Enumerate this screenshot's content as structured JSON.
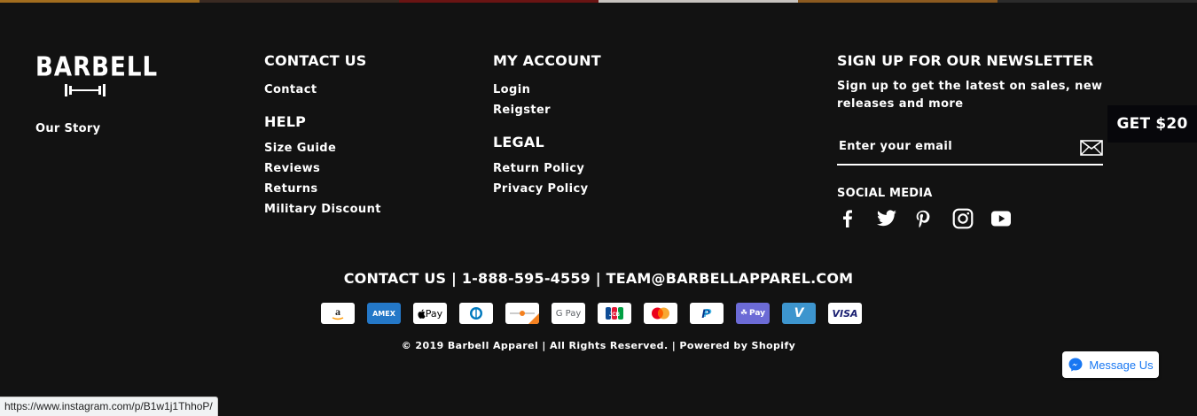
{
  "brand": {
    "logo_text": "BARBELL"
  },
  "left": {
    "our_story": "Our Story"
  },
  "contact_col": {
    "heading": "CONTACT US",
    "links": [
      "Contact"
    ],
    "help_heading": "HELP",
    "help_links": [
      "Size Guide",
      "Reviews",
      "Returns",
      "Military Discount"
    ]
  },
  "account_col": {
    "heading": "MY ACCOUNT",
    "links": [
      "Login",
      "Reigster"
    ],
    "legal_heading": "LEGAL",
    "legal_links": [
      "Return Policy",
      "Privacy Policy"
    ]
  },
  "newsletter": {
    "heading": "SIGN UP FOR OUR NEWSLETTER",
    "description": "Sign up to get the latest on sales, new releases and more",
    "email_placeholder": "Enter your email",
    "social_heading": "SOCIAL MEDIA",
    "social_icons": [
      "facebook-icon",
      "twitter-icon",
      "pinterest-icon",
      "instagram-icon",
      "youtube-icon"
    ]
  },
  "promo": {
    "label": "GET $20"
  },
  "contact_line": "CONTACT US | 1-888-595-4559 | TEAM@BARBELLAPPAREL.COM",
  "payments": [
    {
      "name": "amazon-pay-icon",
      "label": "a"
    },
    {
      "name": "amex-icon",
      "label": "AMEX"
    },
    {
      "name": "apple-pay-icon",
      "label": "Pay"
    },
    {
      "name": "diners-club-icon",
      "label": ""
    },
    {
      "name": "discover-icon",
      "label": ""
    },
    {
      "name": "google-pay-icon",
      "label": "G Pay"
    },
    {
      "name": "jcb-icon",
      "label": "JCB"
    },
    {
      "name": "mastercard-icon",
      "label": ""
    },
    {
      "name": "paypal-icon",
      "label": "P"
    },
    {
      "name": "shop-pay-icon",
      "label": "Pay"
    },
    {
      "name": "venmo-icon",
      "label": "V"
    },
    {
      "name": "visa-icon",
      "label": "VISA"
    }
  ],
  "copyright": "© 2019 Barbell Apparel | All Rights Reserved. | Powered by Shopify",
  "messenger": {
    "label": "Message Us"
  },
  "status_bar": {
    "url": "https://www.instagram.com/p/B1w1j1ThhoP/"
  },
  "colors": {
    "background": "#121212",
    "text": "#ffffff",
    "promo_bg": "#07070b",
    "messenger_blue": "#1877f2"
  }
}
